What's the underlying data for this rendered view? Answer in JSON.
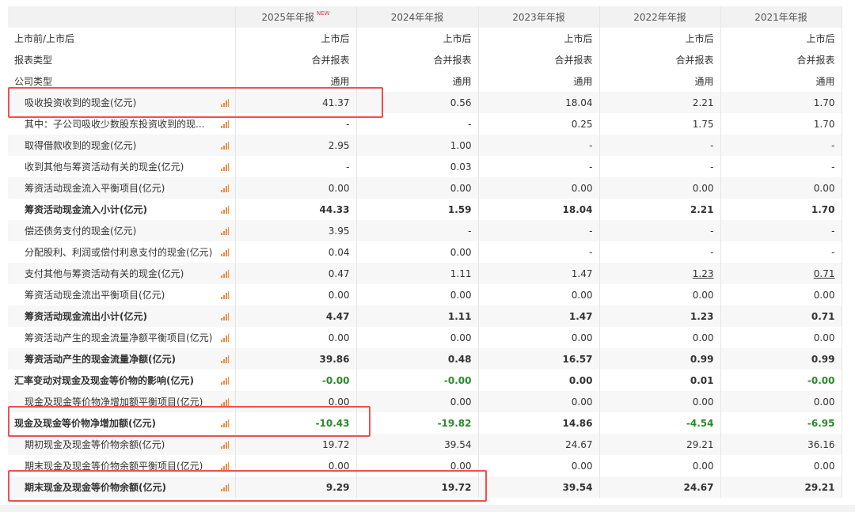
{
  "columns": [
    {
      "label": "2025年年报",
      "badge": "NEW"
    },
    {
      "label": "2024年年报"
    },
    {
      "label": "2023年年报"
    },
    {
      "label": "2022年年报"
    },
    {
      "label": "2021年年报"
    }
  ],
  "rows": [
    {
      "label": "上市前/上市后",
      "level": 0,
      "chart": false,
      "values": [
        "上市后",
        "上市后",
        "上市后",
        "上市后",
        "上市后"
      ]
    },
    {
      "label": "报表类型",
      "level": 0,
      "chart": false,
      "values": [
        "合并报表",
        "合并报表",
        "合并报表",
        "合并报表",
        "合并报表"
      ]
    },
    {
      "label": "公司类型",
      "level": 0,
      "chart": false,
      "values": [
        "通用",
        "通用",
        "通用",
        "通用",
        "通用"
      ]
    },
    {
      "label": "吸收投资收到的现金(亿元)",
      "level": 1,
      "chart": true,
      "values": [
        "41.37",
        "0.56",
        "18.04",
        "2.21",
        "1.70"
      ]
    },
    {
      "label": "其中：子公司吸收少数股东投资收到的现...",
      "level": 1,
      "chart": true,
      "values": [
        "-",
        "-",
        "0.25",
        "1.75",
        "1.70"
      ]
    },
    {
      "label": "取得借款收到的现金(亿元)",
      "level": 1,
      "chart": true,
      "values": [
        "2.95",
        "1.00",
        "-",
        "-",
        "-"
      ]
    },
    {
      "label": "收到其他与筹资活动有关的现金(亿元)",
      "level": 1,
      "chart": true,
      "values": [
        "-",
        "0.03",
        "-",
        "-",
        "-"
      ]
    },
    {
      "label": "筹资活动现金流入平衡项目(亿元)",
      "level": 1,
      "chart": true,
      "values": [
        "0.00",
        "0.00",
        "0.00",
        "0.00",
        "0.00"
      ]
    },
    {
      "label": "筹资活动现金流入小计(亿元)",
      "level": 1,
      "bold": true,
      "chart": true,
      "values": [
        "44.33",
        "1.59",
        "18.04",
        "2.21",
        "1.70"
      ]
    },
    {
      "label": "偿还债务支付的现金(亿元)",
      "level": 1,
      "chart": true,
      "values": [
        "3.95",
        "-",
        "-",
        "-",
        "-"
      ]
    },
    {
      "label": "分配股利、利润或偿付利息支付的现金(亿元)",
      "level": 1,
      "chart": true,
      "values": [
        "0.04",
        "0.00",
        "-",
        "-",
        "-"
      ]
    },
    {
      "label": "支付其他与筹资活动有关的现金(亿元)",
      "level": 1,
      "chart": true,
      "values": [
        "0.47",
        "1.11",
        "1.47",
        "1.23",
        "0.71"
      ],
      "underline": [
        3,
        4
      ]
    },
    {
      "label": "筹资活动现金流出平衡项目(亿元)",
      "level": 1,
      "chart": true,
      "values": [
        "0.00",
        "0.00",
        "0.00",
        "0.00",
        "0.00"
      ]
    },
    {
      "label": "筹资活动现金流出小计(亿元)",
      "level": 1,
      "bold": true,
      "chart": true,
      "values": [
        "4.47",
        "1.11",
        "1.47",
        "1.23",
        "0.71"
      ]
    },
    {
      "label": "筹资活动产生的现金流量净额平衡项目(亿元)",
      "level": 1,
      "chart": true,
      "values": [
        "0.00",
        "0.00",
        "0.00",
        "0.00",
        "0.00"
      ]
    },
    {
      "label": "筹资活动产生的现金流量净额(亿元)",
      "level": 1,
      "bold": true,
      "chart": true,
      "values": [
        "39.86",
        "0.48",
        "16.57",
        "0.99",
        "0.99"
      ]
    },
    {
      "label": "汇率变动对现金及现金等价物的影响(亿元)",
      "level": 0,
      "bold": true,
      "chart": true,
      "values": [
        "-0.00",
        "-0.00",
        "0.00",
        "0.01",
        "-0.00"
      ]
    },
    {
      "label": "现金及现金等价物净增加额平衡项目(亿元)",
      "level": 1,
      "chart": true,
      "values": [
        "0.00",
        "0.00",
        "0.00",
        "0.00",
        "0.00"
      ]
    },
    {
      "label": "现金及现金等价物净增加额(亿元)",
      "level": 0,
      "bold": true,
      "chart": true,
      "values": [
        "-10.43",
        "-19.82",
        "14.86",
        "-4.54",
        "-6.95"
      ]
    },
    {
      "label": "期初现金及现金等价物余额(亿元)",
      "level": 1,
      "chart": true,
      "values": [
        "19.72",
        "39.54",
        "24.67",
        "29.21",
        "36.16"
      ]
    },
    {
      "label": "期末现金及现金等价物余额平衡项目(亿元)",
      "level": 1,
      "chart": true,
      "values": [
        "0.00",
        "0.00",
        "0.00",
        "0.00",
        "0.00"
      ]
    },
    {
      "label": "期末现金及现金等价物余额(亿元)",
      "level": 1,
      "bold": true,
      "chart": true,
      "values": [
        "9.29",
        "19.72",
        "39.54",
        "24.67",
        "29.21"
      ]
    }
  ],
  "colors": {
    "negative": "#2a8a2a",
    "chart_icon": "#f08a3c",
    "highlight_box": "#f05050",
    "new_badge": "#e33333"
  }
}
